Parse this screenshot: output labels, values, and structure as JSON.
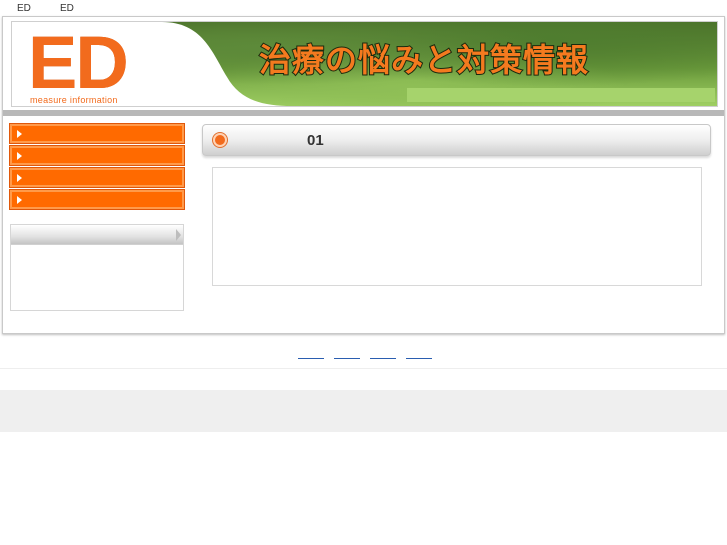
{
  "topbar": {
    "left_text": "ED",
    "right_text": "ED"
  },
  "header": {
    "logo_text": "ED",
    "logo_subtitle": "measure  information",
    "banner_title": "治療の悩みと対策情報",
    "colors": {
      "brand_orange": "#f26b1d",
      "forest_green": "#5d8a3a"
    }
  },
  "sidebar": {
    "menu_items": [
      {
        "label": "",
        "icon": "triangle-right-icon"
      },
      {
        "label": "",
        "icon": "triangle-right-icon"
      },
      {
        "label": "",
        "icon": "triangle-right-icon"
      },
      {
        "label": "",
        "icon": "triangle-right-icon"
      }
    ],
    "box": {
      "title": ""
    }
  },
  "main": {
    "section_title": "01",
    "section_icon": "orange-circle-bullet-icon",
    "content_text": ""
  },
  "footer": {
    "links": [
      "",
      "",
      "",
      ""
    ],
    "link_color": "#2a5db0"
  }
}
